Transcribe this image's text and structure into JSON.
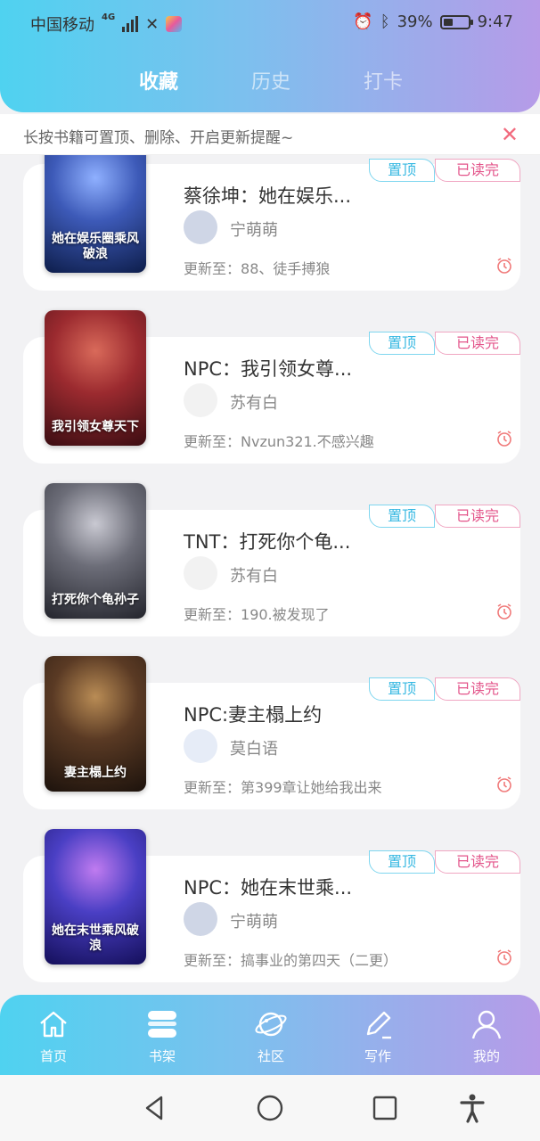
{
  "status_bar": {
    "carrier": "中国移动",
    "network": "4G",
    "battery_percent": "39%",
    "battery_level": 0.39,
    "time": "9:47"
  },
  "tabs": [
    {
      "label": "收藏",
      "active": true
    },
    {
      "label": "历史",
      "active": false
    },
    {
      "label": "打卡",
      "active": false
    }
  ],
  "tip": {
    "text": "长按书籍可置顶、删除、开启更新提醒~",
    "close_icon": "close-icon"
  },
  "tags": {
    "pin": "置顶",
    "read_done": "已读完"
  },
  "books": [
    {
      "title": "蔡徐坤：她在娱乐...",
      "author": "宁萌萌",
      "update_prefix": "更新至：",
      "update": "88、徒手搏狼",
      "cover_text": "她在娱乐圈乘风破浪",
      "cover_colors": [
        "#0d1d4a",
        "#3d5ab8",
        "#8fb0ff"
      ]
    },
    {
      "title": "NPC：我引领女尊...",
      "author": "苏有白",
      "update_prefix": "更新至：",
      "update": "Nvzun321.不感兴趣",
      "cover_text": "我引领女尊天下",
      "cover_colors": [
        "#3b0d12",
        "#9b2a2f",
        "#d96a5a"
      ]
    },
    {
      "title": "TNT：打死你个龟...",
      "author": "苏有白",
      "update_prefix": "更新至：",
      "update": "190.被发现了",
      "cover_text": "打死你个龟孙子",
      "cover_colors": [
        "#23242c",
        "#6c6d78",
        "#c9c9d2"
      ]
    },
    {
      "title": "NPC:妻主榻上约",
      "author": "莫白语",
      "update_prefix": "更新至：",
      "update": "第399章让她给我出来",
      "cover_text": "妻主榻上约",
      "cover_colors": [
        "#1c120c",
        "#5a3a24",
        "#b98c55"
      ]
    },
    {
      "title": "NPC：她在末世乘...",
      "author": "宁萌萌",
      "update_prefix": "更新至：",
      "update": "搞事业的第四天（二更）",
      "cover_text": "她在末世乘风破浪",
      "cover_colors": [
        "#140f5a",
        "#4a3fc4",
        "#c07bf0"
      ]
    }
  ],
  "bottom_nav": [
    {
      "label": "首页",
      "icon": "home-icon"
    },
    {
      "label": "书架",
      "icon": "bookshelf-icon"
    },
    {
      "label": "社区",
      "icon": "planet-icon"
    },
    {
      "label": "写作",
      "icon": "pen-icon"
    },
    {
      "label": "我的",
      "icon": "user-icon"
    }
  ],
  "colors": {
    "gradient_start": "#4fd2f0",
    "gradient_end": "#b69be8",
    "pin_tag": "#36b8e2",
    "read_tag": "#e3548a",
    "alarm": "#f07a7a"
  }
}
